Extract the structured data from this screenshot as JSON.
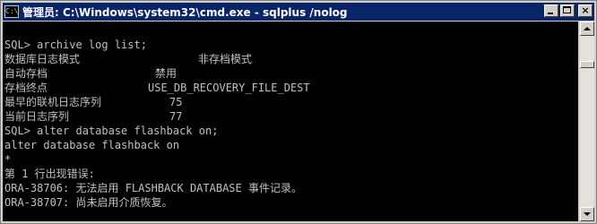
{
  "window": {
    "icon_text": "C:\\",
    "title": "管理员: C:\\Windows\\system32\\cmd.exe - sqlplus  /nolog",
    "controls": {
      "minimize": "minimize",
      "maximize": "maximize",
      "close": "×"
    }
  },
  "console": {
    "lines": [
      {
        "a": "SQL> archive log list;",
        "b": ""
      },
      {
        "a": "数据库日志模式",
        "b": "非存档模式"
      },
      {
        "a": "自动存档",
        "b": "禁用"
      },
      {
        "a": "存档终点",
        "b": "USE_DB_RECOVERY_FILE_DEST"
      },
      {
        "a": "最早的联机日志序列",
        "b": "75"
      },
      {
        "a": "当前日志序列",
        "b": "77"
      },
      {
        "a": "SQL> alter database flashback on;",
        "b": ""
      },
      {
        "a": "alter database flashback on",
        "b": ""
      },
      {
        "a": "*",
        "b": ""
      },
      {
        "a": "第 1 行出现错误:",
        "b": ""
      },
      {
        "a": "ORA-38706: 无法启用 FLASHBACK DATABASE 事件记录。",
        "b": ""
      },
      {
        "a": "ORA-38707: 尚未启用介质恢复。",
        "b": ""
      }
    ]
  },
  "colors": {
    "titlebar": "#0a246a",
    "console_bg": "#000000",
    "console_text": "#c0c0c0"
  }
}
